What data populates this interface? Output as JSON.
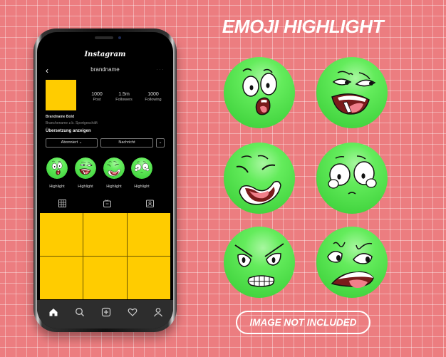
{
  "title": "EMOJI HIGHLIGHT",
  "disclaimer": "IMAGE NOT INCLUDED",
  "colors": {
    "background": "#ec7d80",
    "emoji_green": "#5ee85a",
    "placeholder_yellow": "#ffcc00",
    "phone_screen": "#000000",
    "nav_bar": "#2d2d2d"
  },
  "phone": {
    "app_name": "Instagram",
    "username": "brandname",
    "stats": [
      {
        "value": "1000",
        "label": "Post"
      },
      {
        "value": "1.5m",
        "label": "Followers"
      },
      {
        "value": "1000",
        "label": "Following"
      }
    ],
    "bio": {
      "name": "Brandname Bold",
      "category": "Branchename z.b. Sportgeschäft",
      "translate": "Übersetzung anzeigen"
    },
    "buttons": {
      "follow": "Abonniert ⌄",
      "message": "Nachricht",
      "more": "⌄"
    },
    "highlights": [
      {
        "label": "Highlight",
        "expression": "shocked"
      },
      {
        "label": "Highlight",
        "expression": "smug"
      },
      {
        "label": "Highlight",
        "expression": "laughing"
      },
      {
        "label": "Highlight",
        "expression": "sad"
      }
    ],
    "profile_tabs": [
      "grid-icon",
      "reels-icon",
      "tagged-icon"
    ],
    "nav_icons": [
      "home-icon",
      "search-icon",
      "add-post-icon",
      "heart-icon",
      "profile-icon"
    ]
  },
  "emojis": [
    {
      "expression": "shocked"
    },
    {
      "expression": "smug"
    },
    {
      "expression": "laughing"
    },
    {
      "expression": "sad"
    },
    {
      "expression": "angry"
    },
    {
      "expression": "disgusted"
    }
  ]
}
